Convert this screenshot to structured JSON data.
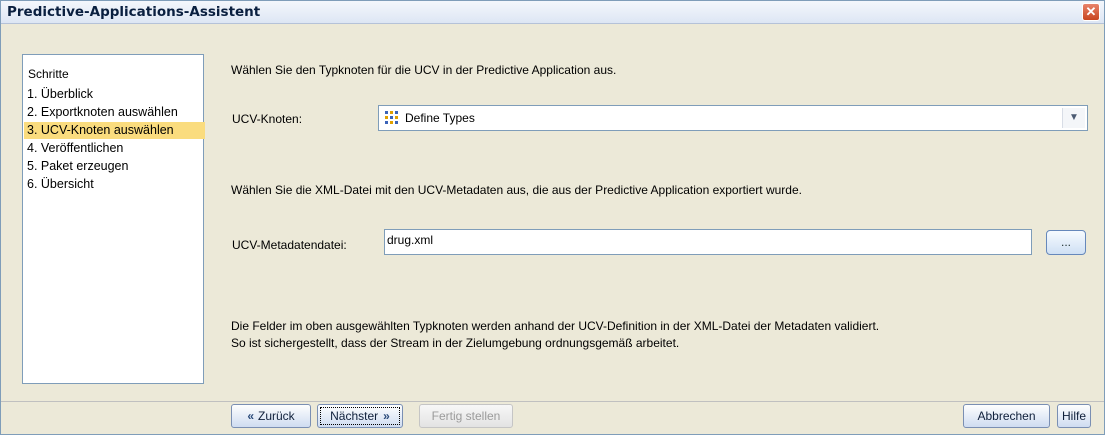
{
  "window": {
    "title": "Predictive-Applications-Assistent"
  },
  "steps": {
    "header": "Schritte",
    "items": [
      {
        "label": "1. Überblick"
      },
      {
        "label": "2. Exportknoten auswählen"
      },
      {
        "label": "3. UCV-Knoten auswählen"
      },
      {
        "label": "4. Veröffentlichen"
      },
      {
        "label": "5. Paket erzeugen"
      },
      {
        "label": "6. Übersicht"
      }
    ],
    "active_index": 2
  },
  "main": {
    "intro": "Wählen Sie den Typknoten für die UCV in der Predictive Application aus.",
    "ucv_label": "UCV-Knoten:",
    "ucv_value": "Define Types",
    "xml_hint": "Wählen Sie die XML-Datei mit den UCV-Metadaten aus, die aus der  Predictive Application exportiert wurde.",
    "meta_label": "UCV-Metadatendatei:",
    "meta_value": "drug.xml",
    "browse_label": "...",
    "note_line1": "Die Felder im oben ausgewählten Typknoten werden anhand der UCV-Definition in der XML-Datei der Metadaten validiert.",
    "note_line2": "So ist sichergestellt, dass der Stream in der Zielumgebung ordnungsgemäß arbeitet."
  },
  "buttons": {
    "back": "Zurück",
    "next": "Nächster",
    "finish": "Fertig stellen",
    "cancel": "Abbrechen",
    "help": "Hilfe"
  },
  "icons": {
    "close": "close-icon",
    "node": "type-node-icon",
    "dropdown": "chevron-down-icon",
    "back": "double-chevron-left-icon",
    "next": "double-chevron-right-icon"
  },
  "colors": {
    "highlight": "#fadc7e",
    "titlebar_close": "#d45a36"
  }
}
